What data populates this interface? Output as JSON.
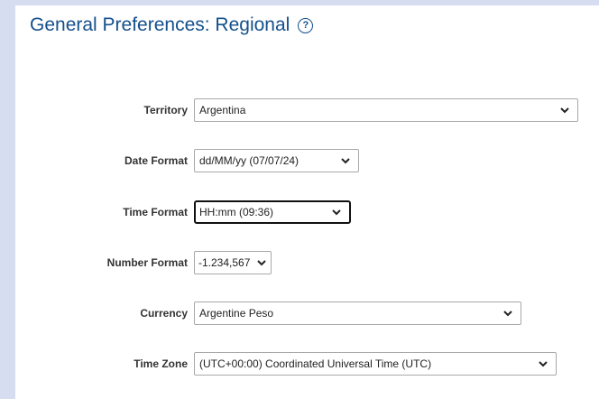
{
  "page": {
    "title": "General Preferences: Regional",
    "help_icon": "question-circle-icon"
  },
  "fields": {
    "territory": {
      "label": "Territory",
      "value": "Argentina"
    },
    "date_format": {
      "label": "Date Format",
      "value": "dd/MM/yy (07/07/24)"
    },
    "time_format": {
      "label": "Time Format",
      "value": "HH:mm (09:36)"
    },
    "number_format": {
      "label": "Number Format",
      "value": "-1.234,567"
    },
    "currency": {
      "label": "Currency",
      "value": "Argentine Peso"
    },
    "time_zone": {
      "label": "Time Zone",
      "value": "(UTC+00:00) Coordinated Universal Time (UTC)"
    }
  },
  "colors": {
    "background": "#d6ddf0",
    "panel": "#ffffff",
    "title": "#14508c"
  }
}
